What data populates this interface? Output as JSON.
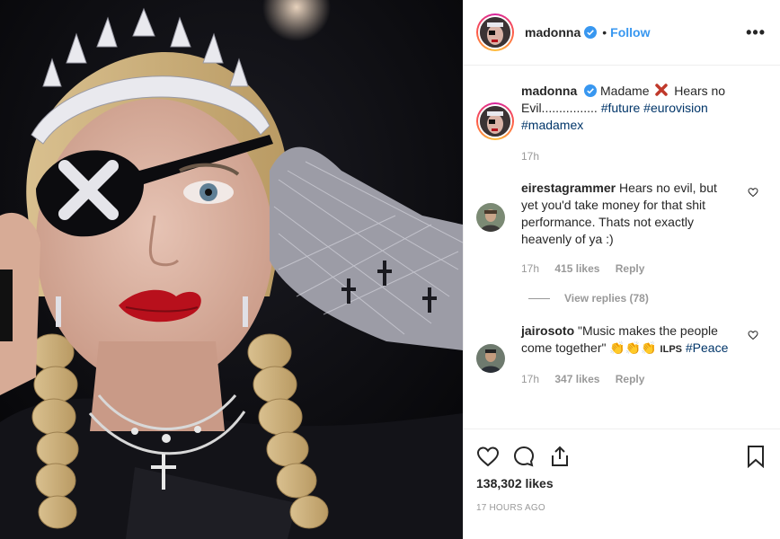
{
  "post": {
    "author": "madonna",
    "follow_label": "Follow",
    "separator": "•",
    "more_label": "•••",
    "image_alt": "Madonna wearing a crown and an eye patch with an X"
  },
  "caption": {
    "username": "madonna",
    "text_1": "Madame",
    "text_2": "Hears no Evil................",
    "hashtags": [
      "#future",
      "#eurovision",
      "#madamex"
    ],
    "time": "17h"
  },
  "comments": [
    {
      "username": "eirestagrammer",
      "text": "Hears no evil, but yet you'd take money for that shit performance. Thats not exactly heavenly of ya :)",
      "time": "17h",
      "likes": "415 likes",
      "reply": "Reply",
      "view_replies": "View replies (78)"
    },
    {
      "username": "jairosoto",
      "text": "\"Music makes the people come together\"",
      "emoji": "👏👏👏",
      "suffix": "ILPS",
      "hashtag": "#Peace",
      "time": "17h",
      "likes": "347 likes",
      "reply": "Reply"
    }
  ],
  "footer": {
    "likes": "138,302 likes",
    "time_ago": "17 HOURS AGO"
  },
  "colors": {
    "accent": "#3897f0",
    "hashtag": "#003569",
    "meta": "#999999",
    "verified": "#3897f0"
  }
}
